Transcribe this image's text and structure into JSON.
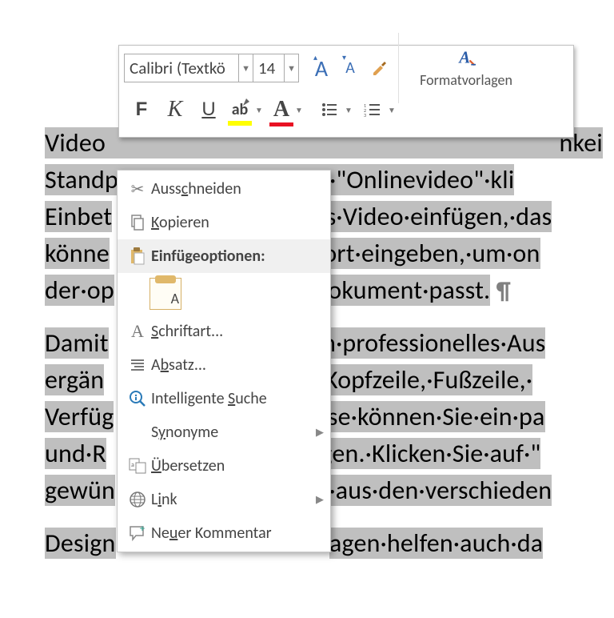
{
  "mini_toolbar": {
    "font_name": "Calibri (Textkö",
    "font_size": "14",
    "increase_font": "A",
    "decrease_font": "A",
    "format_painter": "✎",
    "styles_label": "Formatvorlagen",
    "bold": "F",
    "italic": "K",
    "underline": "U"
  },
  "context_menu": {
    "cut": "Ausschneiden",
    "copy": "Kopieren",
    "paste_label": "Einfügeoptionen:",
    "paste_text_only": "A",
    "font": "Schriftart...",
    "paragraph": "Absatz...",
    "smart_lookup": "Intelligente Suche",
    "synonyms": "Synonyme",
    "translate": "Übersetzen",
    "link": "Link",
    "new_comment": "Neuer Kommentar"
  },
  "document": {
    "p1_a": "Video",
    "p1_b": "nkei",
    "p2": "Standpunkts.·Wenn·Sie·auf·\"Onlinevideo\"·kli",
    "p3a": "Einbet",
    "p3b": "s·Video·einfügen,·das",
    "p4a": "könne",
    "p4b": "ort·eingeben,·um·on",
    "p5a": "der·op",
    "p5b": "okument·passt.",
    "p6a": "Damit",
    "p6b": "n·professionelles·Aus",
    "p7a": "ergän",
    "p7b": "·Kopfzeile,·Fußzeile,·",
    "p8a": "Verfüg",
    "p8b": "se·können·Sie·ein·pa",
    "p9a": "und·R",
    "p9b": "gen.·Klicken·Sie·auf·\"",
    "p10a": "gewün",
    "p10b": "·aus·den·verschieden",
    "p11a": "Design",
    "p11b": "agen·helfen·auch·da"
  }
}
